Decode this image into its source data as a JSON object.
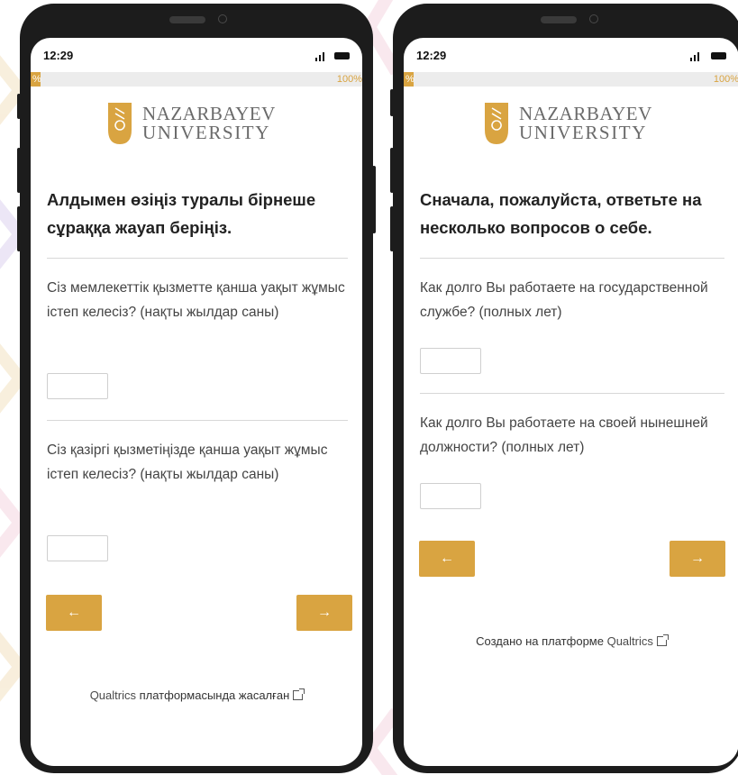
{
  "colors": {
    "accent": "#d9a441",
    "phone_frame": "#1c1c1c",
    "text": "#222222"
  },
  "phones": [
    {
      "time": "12:29",
      "progress": {
        "start_label": "%",
        "end_label": "100%",
        "value_percent": 3
      },
      "logo": {
        "line1": "NAZARBAYEV",
        "line2": "UNIVERSITY"
      },
      "heading": "Алдымен өзіңіз туралы бірнеше сұраққа жауап беріңіз.",
      "questions": [
        {
          "text": "Сіз мемлекеттік қызметте қанша уақыт жұмыс істеп келесіз? (нақты жылдар саны)",
          "value": ""
        },
        {
          "text": "Сіз қазіргі қызметіңізде қанша уақыт жұмыс істеп келесіз? (нақты жылдар саны)",
          "value": ""
        }
      ],
      "back_label": "←",
      "next_label": "→",
      "footer": {
        "prefix": "",
        "brand": "Qualtrics",
        "suffix": " платформасында жасалған"
      }
    },
    {
      "time": "12:29",
      "progress": {
        "start_label": "%",
        "end_label": "100%",
        "value_percent": 3
      },
      "logo": {
        "line1": "NAZARBAYEV",
        "line2": "UNIVERSITY"
      },
      "heading": "Сначала, пожалуйста, ответьте на несколько вопросов о себе.",
      "questions": [
        {
          "text": "Как долго Вы работаете на государственной службе? (полных лет)",
          "value": ""
        },
        {
          "text": "Как долго Вы работаете на своей нынешней должности? (полных лет)",
          "value": ""
        }
      ],
      "back_label": "←",
      "next_label": "→",
      "footer": {
        "prefix": "Создано на платформе ",
        "brand": "Qualtrics",
        "suffix": ""
      }
    }
  ]
}
